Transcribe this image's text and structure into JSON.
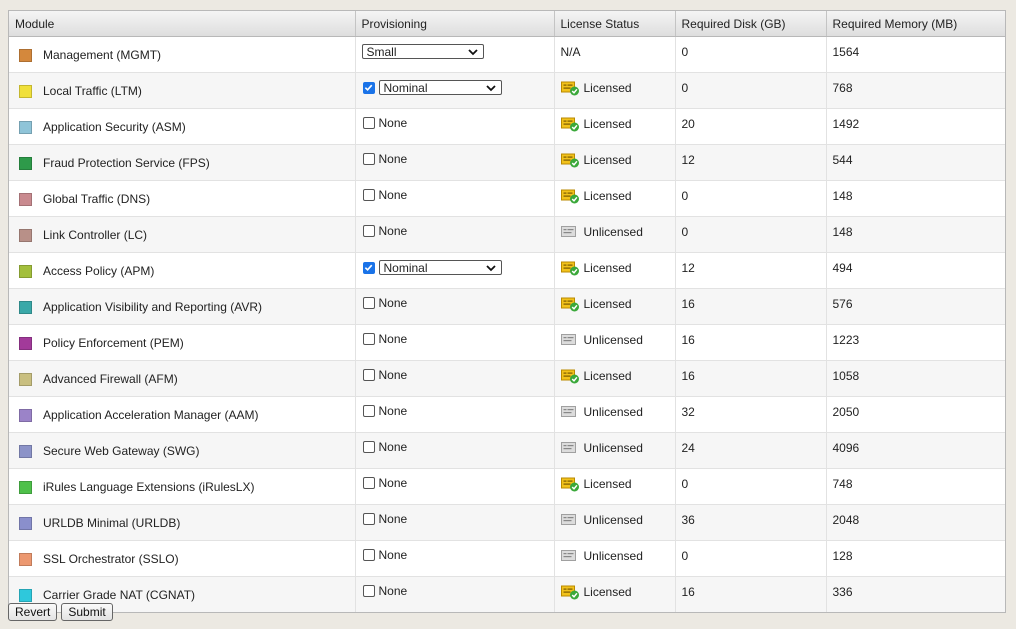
{
  "columns": [
    "Module",
    "Provisioning",
    "License Status",
    "Required Disk (GB)",
    "Required Memory (MB)"
  ],
  "rows": [
    {
      "module": "Management (MGMT)",
      "color": "#d4883c",
      "type": "select",
      "checked": false,
      "provisioning": "Small",
      "license": "N/A",
      "license_icon": "none",
      "disk": "0",
      "memory": "1564"
    },
    {
      "module": "Local Traffic (LTM)",
      "color": "#f0e03a",
      "type": "checkselect",
      "checked": true,
      "provisioning": "Nominal",
      "license": "Licensed",
      "license_icon": "licensed",
      "disk": "0",
      "memory": "768"
    },
    {
      "module": "Application Security (ASM)",
      "color": "#8fc4d8",
      "type": "check",
      "checked": false,
      "provisioning": "None",
      "license": "Licensed",
      "license_icon": "licensed",
      "disk": "20",
      "memory": "1492"
    },
    {
      "module": "Fraud Protection Service (FPS)",
      "color": "#2e9a4a",
      "type": "check",
      "checked": false,
      "provisioning": "None",
      "license": "Licensed",
      "license_icon": "licensed",
      "disk": "12",
      "memory": "544"
    },
    {
      "module": "Global Traffic (DNS)",
      "color": "#c98a8f",
      "type": "check",
      "checked": false,
      "provisioning": "None",
      "license": "Licensed",
      "license_icon": "licensed",
      "disk": "0",
      "memory": "148"
    },
    {
      "module": "Link Controller (LC)",
      "color": "#b89088",
      "type": "check",
      "checked": false,
      "provisioning": "None",
      "license": "Unlicensed",
      "license_icon": "unlicensed",
      "disk": "0",
      "memory": "148"
    },
    {
      "module": "Access Policy (APM)",
      "color": "#a3bf3c",
      "type": "checkselect",
      "checked": true,
      "provisioning": "Nominal",
      "license": "Licensed",
      "license_icon": "licensed",
      "disk": "12",
      "memory": "494"
    },
    {
      "module": "Application Visibility and Reporting (AVR)",
      "color": "#3aa8a8",
      "type": "check",
      "checked": false,
      "provisioning": "None",
      "license": "Licensed",
      "license_icon": "licensed",
      "disk": "16",
      "memory": "576"
    },
    {
      "module": "Policy Enforcement (PEM)",
      "color": "#a23a9a",
      "type": "check",
      "checked": false,
      "provisioning": "None",
      "license": "Unlicensed",
      "license_icon": "unlicensed",
      "disk": "16",
      "memory": "1223"
    },
    {
      "module": "Advanced Firewall (AFM)",
      "color": "#c9bf80",
      "type": "check",
      "checked": false,
      "provisioning": "None",
      "license": "Licensed",
      "license_icon": "licensed",
      "disk": "16",
      "memory": "1058"
    },
    {
      "module": "Application Acceleration Manager (AAM)",
      "color": "#9b83c8",
      "type": "check",
      "checked": false,
      "provisioning": "None",
      "license": "Unlicensed",
      "license_icon": "unlicensed",
      "disk": "32",
      "memory": "2050"
    },
    {
      "module": "Secure Web Gateway (SWG)",
      "color": "#8c93c8",
      "type": "check",
      "checked": false,
      "provisioning": "None",
      "license": "Unlicensed",
      "license_icon": "unlicensed",
      "disk": "24",
      "memory": "4096"
    },
    {
      "module": "iRules Language Extensions (iRulesLX)",
      "color": "#4ec04a",
      "type": "check",
      "checked": false,
      "provisioning": "None",
      "license": "Licensed",
      "license_icon": "licensed",
      "disk": "0",
      "memory": "748"
    },
    {
      "module": "URLDB Minimal (URLDB)",
      "color": "#8a8fcc",
      "type": "check",
      "checked": false,
      "provisioning": "None",
      "license": "Unlicensed",
      "license_icon": "unlicensed",
      "disk": "36",
      "memory": "2048"
    },
    {
      "module": "SSL Orchestrator (SSLO)",
      "color": "#ec9870",
      "type": "check",
      "checked": false,
      "provisioning": "None",
      "license": "Unlicensed",
      "license_icon": "unlicensed",
      "disk": "0",
      "memory": "128"
    },
    {
      "module": "Carrier Grade NAT (CGNAT)",
      "color": "#2ec8dc",
      "type": "check",
      "checked": false,
      "provisioning": "None",
      "license": "Licensed",
      "license_icon": "licensed",
      "disk": "16",
      "memory": "336"
    }
  ],
  "buttons": {
    "revert": "Revert",
    "submit": "Submit"
  }
}
